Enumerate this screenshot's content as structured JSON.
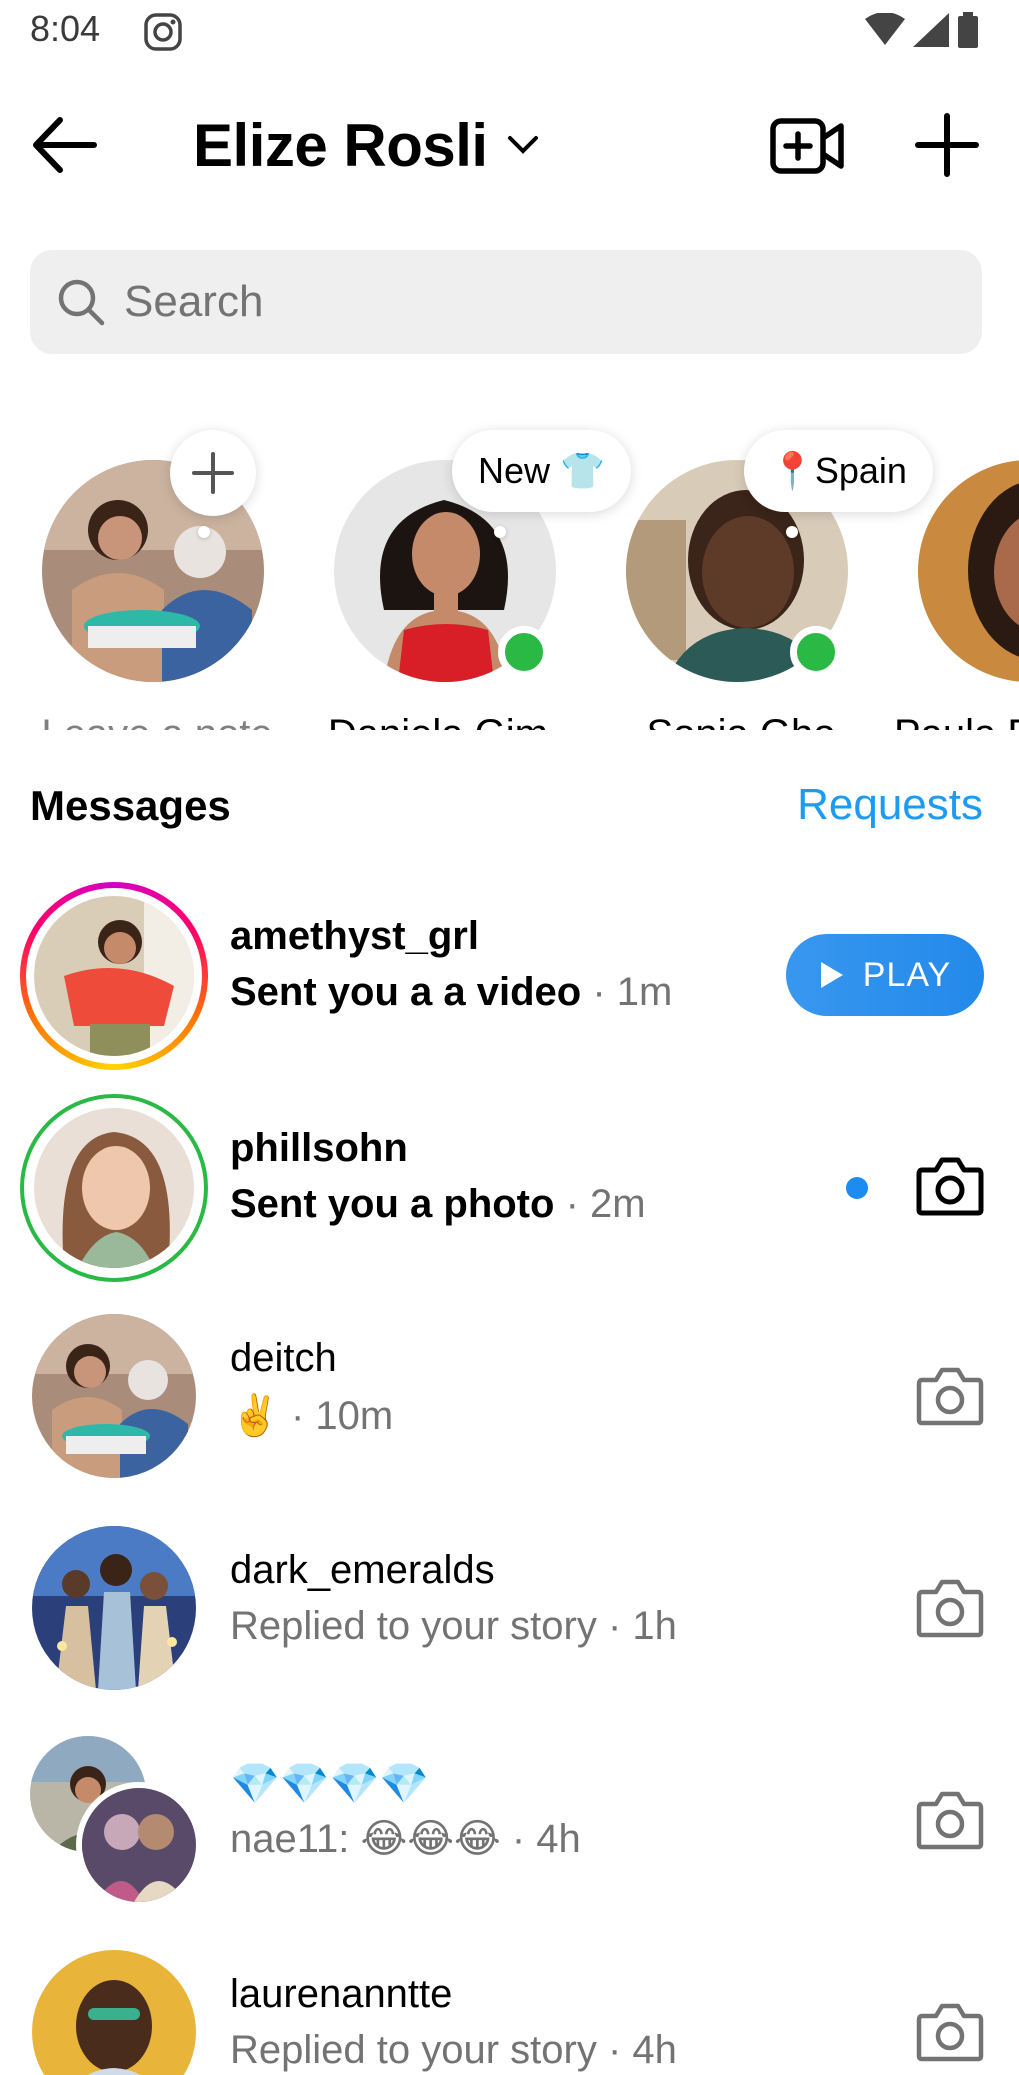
{
  "status_bar": {
    "time": "8:04"
  },
  "header": {
    "account_name": "Elize Rosli"
  },
  "search": {
    "placeholder": "Search"
  },
  "notes": [
    {
      "label": "Leave a note",
      "bubble": ""
    },
    {
      "label": "Daniela Gim..",
      "bubble": "New 👕"
    },
    {
      "label": "Sonja Gho",
      "bubble": "📍Spain"
    },
    {
      "label": "Paula E",
      "bubble": ""
    }
  ],
  "messages": {
    "title": "Messages",
    "requests": "Requests",
    "threads": [
      {
        "name": "amethyst_grl",
        "preview": "Sent you a a video",
        "time": "· 1m",
        "action": "PLAY",
        "unread": true
      },
      {
        "name": "phillsohn",
        "preview": "Sent you a photo",
        "time": "· 2m",
        "unread": true
      },
      {
        "name": "deitch",
        "preview": "✌️",
        "time": "· 10m",
        "unread": false
      },
      {
        "name": "dark_emeralds",
        "preview": "Replied to your story",
        "time": "· 1h",
        "unread": false
      },
      {
        "name": "💎💎💎💎",
        "preview": "nae11: 😂😂😂",
        "time": "· 4h",
        "unread": false
      },
      {
        "name": "laurenanntte",
        "preview": "Replied to your story",
        "time": "· 4h",
        "unread": false
      }
    ]
  },
  "colors": {
    "accent": "#1d9bf0",
    "online": "#2ab944",
    "search_bg": "#efefef"
  }
}
